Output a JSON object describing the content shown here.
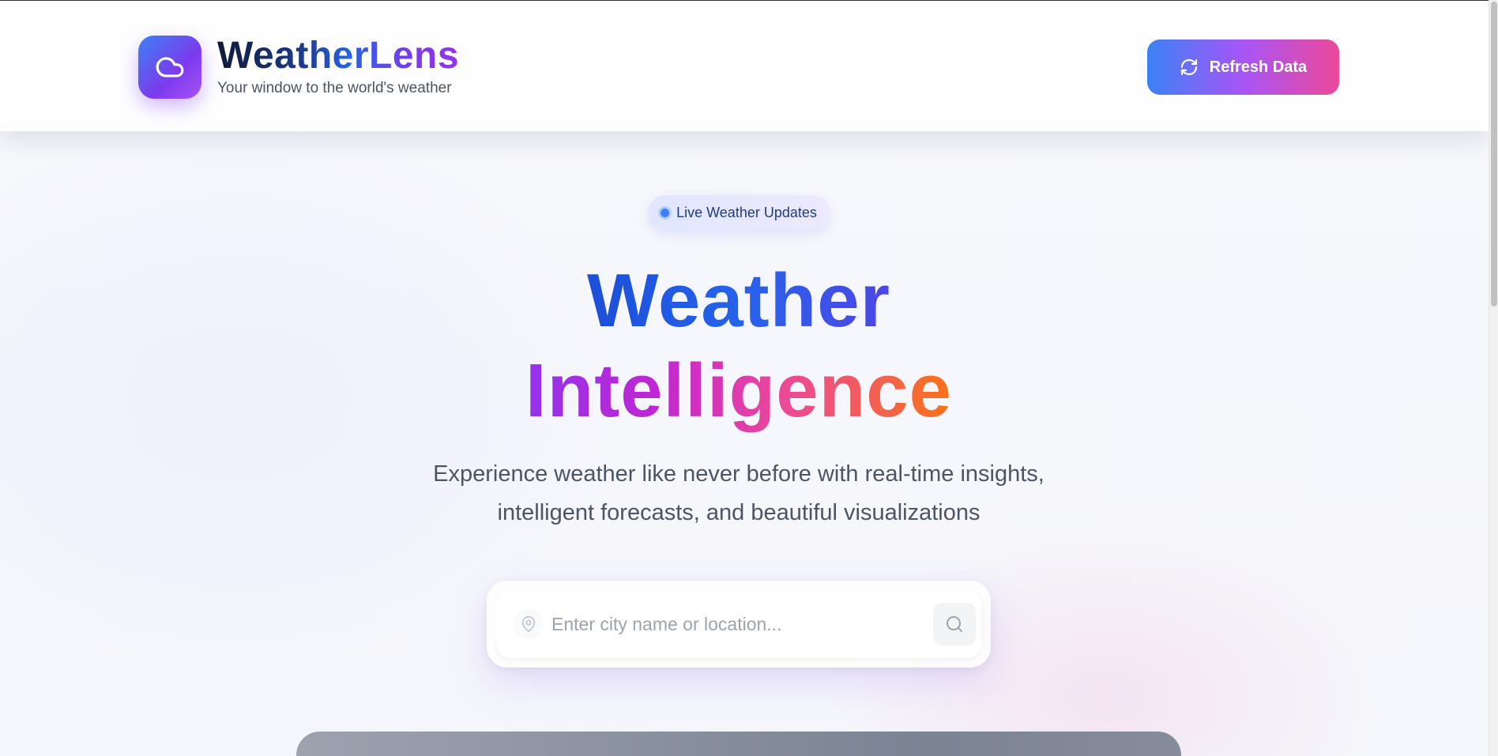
{
  "header": {
    "brand_title": "WeatherLens",
    "brand_subtitle": "Your window to the world's weather",
    "logo_icon": "cloud-icon",
    "refresh_label": "Refresh Data",
    "refresh_icon": "refresh-icon"
  },
  "hero": {
    "badge_label": "Live Weather Updates",
    "title_line1": "Weather",
    "title_line2": "Intelligence",
    "description_line1": "Experience weather like never before with real-time insights,",
    "description_line2": "intelligent forecasts, and beautiful visualizations"
  },
  "search": {
    "placeholder": "Enter city name or location...",
    "value": "",
    "location_icon": "map-pin-icon",
    "search_icon": "search-icon"
  },
  "colors": {
    "accent_blue": "#3b82f6",
    "accent_purple": "#a855f7",
    "accent_pink": "#ec4899",
    "accent_orange": "#f97316"
  }
}
